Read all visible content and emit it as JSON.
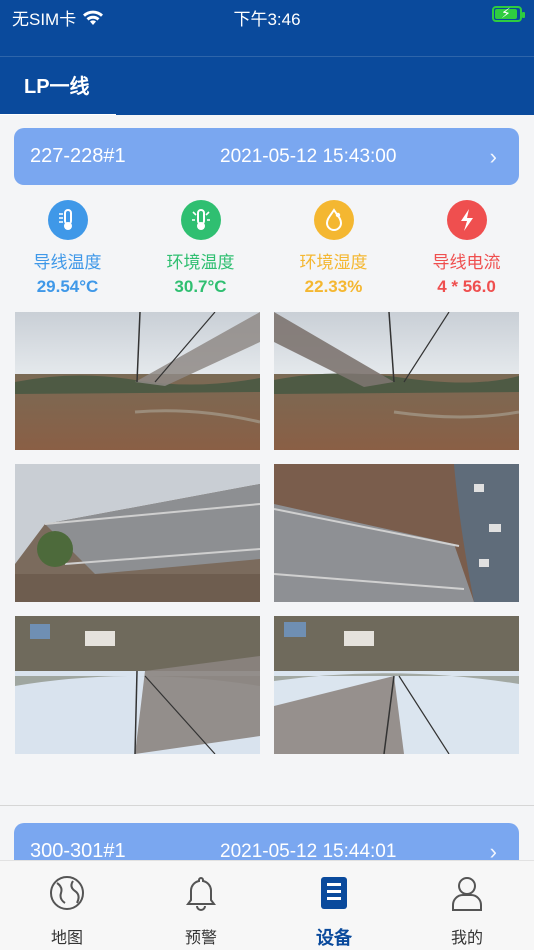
{
  "status_bar": {
    "carrier": "无SIM卡",
    "time": "下午3:46",
    "wifi_icon": "wifi-icon",
    "battery_icon": "battery-charging-icon"
  },
  "header": {
    "title": "LP一线"
  },
  "devices": [
    {
      "name": "227-228#1",
      "time": "2021-05-12 15:43:00",
      "sensors": [
        {
          "icon": "thermometer-icon",
          "label": "导线温度",
          "value": "29.54°C",
          "color": "#3f98e8"
        },
        {
          "icon": "env-thermometer-icon",
          "label": "环境温度",
          "value": "30.7°C",
          "color": "#2fbf71"
        },
        {
          "icon": "humidity-icon",
          "label": "环境湿度",
          "value": "22.33%",
          "color": "#f4b731"
        },
        {
          "icon": "lightning-icon",
          "label": "导线电流",
          "value": "4 * 56.0",
          "color": "#ef4f4f"
        }
      ]
    },
    {
      "name": "300-301#1",
      "time": "2021-05-12 15:44:01"
    }
  ],
  "tabbar": {
    "items": [
      {
        "label": "地图",
        "icon": "globe-icon"
      },
      {
        "label": "预警",
        "icon": "bell-icon"
      },
      {
        "label": "设备",
        "icon": "clipboard-icon",
        "active": true
      },
      {
        "label": "我的",
        "icon": "person-icon"
      }
    ],
    "active_color": "#0a4a9c"
  },
  "colors": {
    "primary": "#0a4a9c",
    "device_header": "#7aa7f0"
  }
}
